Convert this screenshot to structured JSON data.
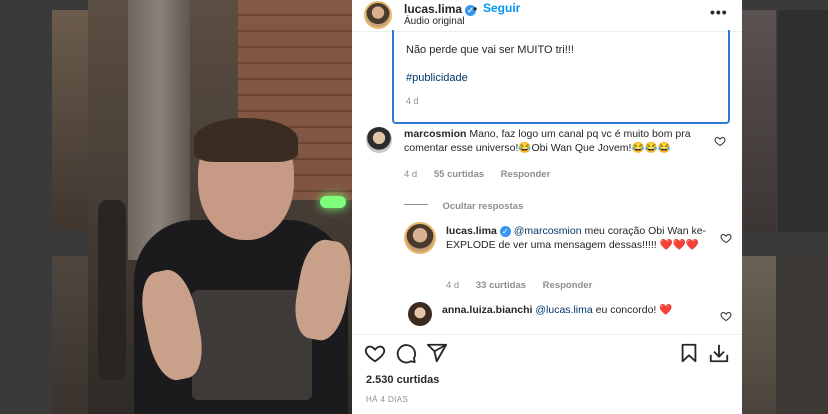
{
  "post": {
    "username": "lucas.lima",
    "separator": "•",
    "follow_label": "Seguir",
    "audio_label": "Áudio original",
    "more_label": "•••"
  },
  "caption": {
    "text": "Não perde que vai ser MUITO tri!!!",
    "hashtag": "#publicidade",
    "time": "4 d"
  },
  "comments": [
    {
      "username": "marcosmion",
      "text": "Mano, faz logo um canal pq vc é muito bom pra comentar esse universo!😂Obi Wan Que Jovem!😂😂😂",
      "time": "4 d",
      "likes": "55 curtidas",
      "reply_label": "Responder"
    }
  ],
  "hide_replies_label": "Ocultar respostas",
  "replies": [
    {
      "username": "lucas.lima",
      "mention": "@marcosmion",
      "text": " meu coração Obi Wan ke-EXPLODE de ver uma mensagem dessas!!!!! ❤️❤️❤️",
      "time": "4 d",
      "likes": "33 curtidas",
      "reply_label": "Responder"
    },
    {
      "username": "anna.luiza.bianchi",
      "mention": "@lucas.lima",
      "text": " eu concordo! ❤️"
    }
  ],
  "footer": {
    "likes": "2.530 curtidas",
    "date": "HÁ 4 DIAS"
  },
  "icons": {
    "like": "heart-icon",
    "comment": "comment-icon",
    "share": "share-icon",
    "save": "bookmark-icon",
    "download": "download-icon"
  },
  "colors": {
    "accent": "#0095f6",
    "highlight_border": "#3478cf",
    "meta": "#8e8e8e",
    "text": "#262626"
  }
}
